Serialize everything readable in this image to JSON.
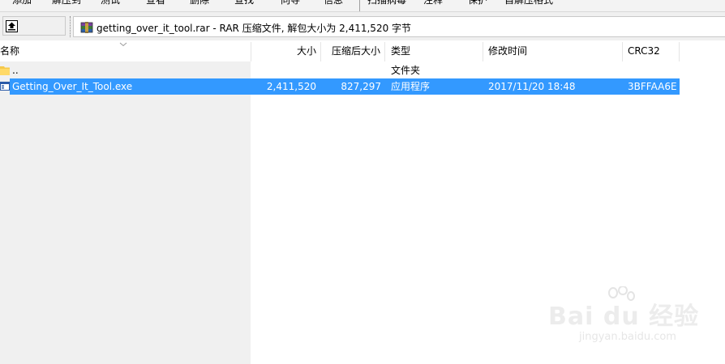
{
  "toolbar": {
    "items": [
      "添加",
      "解压到",
      "测试",
      "查看",
      "删除",
      "查找",
      "向导",
      "信息",
      "扫描病毒",
      "注释",
      "保护",
      "自解压格式"
    ]
  },
  "path_bar": {
    "text": "getting_over_it_tool.rar - RAR 压缩文件, 解包大小为 2,411,520 字节"
  },
  "columns": {
    "name": "名称",
    "size": "大小",
    "packed": "压缩后大小",
    "type": "类型",
    "modified": "修改时间",
    "crc": "CRC32"
  },
  "rows": [
    {
      "name": "..",
      "size": "",
      "packed": "",
      "type": "文件夹",
      "modified": "",
      "crc": ""
    },
    {
      "name": "Getting_Over_It_Tool.exe",
      "size": "2,411,520",
      "packed": "827,297",
      "type": "应用程序",
      "modified": "2017/11/20 18:48",
      "crc": "3BFFAA6E"
    }
  ],
  "colors": {
    "selection": "#3399ff",
    "panel": "#f0f0f0"
  },
  "watermark": {
    "brand": "Bai du 经验",
    "site": "jingyan.baidu.com"
  }
}
